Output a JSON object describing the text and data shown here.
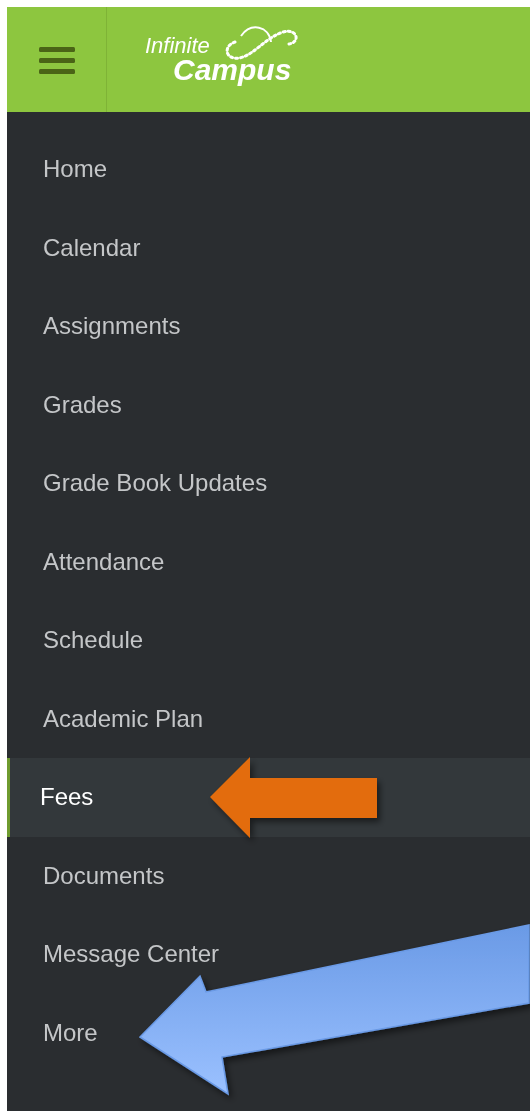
{
  "header": {
    "logo_line_1": "Infinite",
    "logo_line_2": "Campus"
  },
  "nav_items": [
    {
      "label": "Home",
      "selected": false
    },
    {
      "label": "Calendar",
      "selected": false
    },
    {
      "label": "Assignments",
      "selected": false
    },
    {
      "label": "Grades",
      "selected": false
    },
    {
      "label": "Grade Book Updates",
      "selected": false
    },
    {
      "label": "Attendance",
      "selected": false
    },
    {
      "label": "Schedule",
      "selected": false
    },
    {
      "label": "Academic Plan",
      "selected": false
    },
    {
      "label": "Fees",
      "selected": true
    },
    {
      "label": "Documents",
      "selected": false
    },
    {
      "label": "Message Center",
      "selected": false
    },
    {
      "label": "More",
      "selected": false
    }
  ],
  "annotations": [
    {
      "kind": "short-arrow",
      "color": "#e36c0a"
    },
    {
      "kind": "long-arrow",
      "color": "#6a9ae6"
    }
  ]
}
